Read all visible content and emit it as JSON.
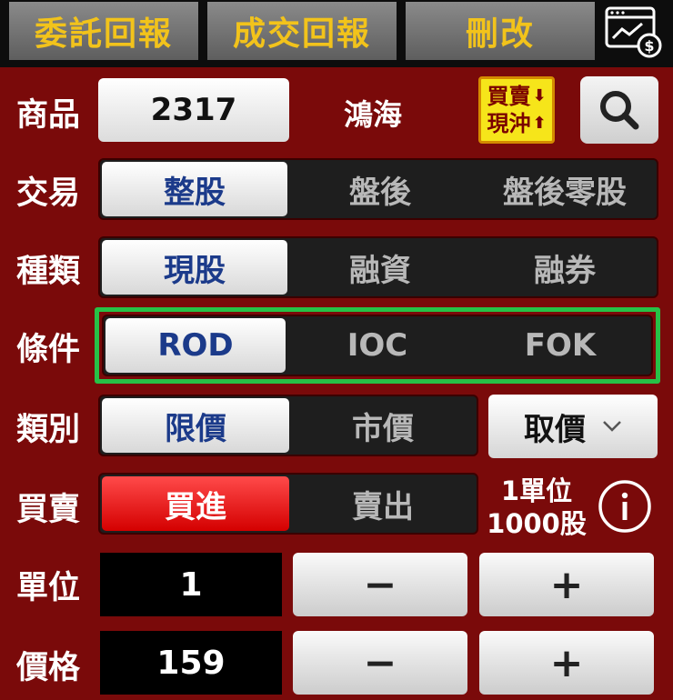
{
  "top_tabs": {
    "orders": "委託回報",
    "fills": "成交回報",
    "modify": "刪改"
  },
  "labels": {
    "product": "商品",
    "trade": "交易",
    "kind": "種類",
    "condition": "條件",
    "category": "類別",
    "side": "買賣",
    "unit": "單位",
    "price": "價格"
  },
  "product": {
    "code": "2317",
    "name": "鴻海"
  },
  "day_trade_badge": {
    "line1": "買賣",
    "line2": "現沖"
  },
  "trade_options": [
    "整股",
    "盤後",
    "盤後零股"
  ],
  "kind_options": [
    "現股",
    "融資",
    "融券"
  ],
  "condition_options": [
    "ROD",
    "IOC",
    "FOK"
  ],
  "category_options": [
    "限價",
    "市價"
  ],
  "price_source": "取價",
  "side_options": [
    "買進",
    "賣出"
  ],
  "unit_info": {
    "line1": "1單位",
    "line2": "1000股"
  },
  "quantity": "1",
  "price": "159",
  "stepper": {
    "minus": "−",
    "plus": "+"
  },
  "colors": {
    "background": "#7a0a0a",
    "top_tab_text": "#f2c31b",
    "selected_text": "#1b3a8a",
    "buy": "#e01010",
    "highlight_border": "#27c147"
  }
}
